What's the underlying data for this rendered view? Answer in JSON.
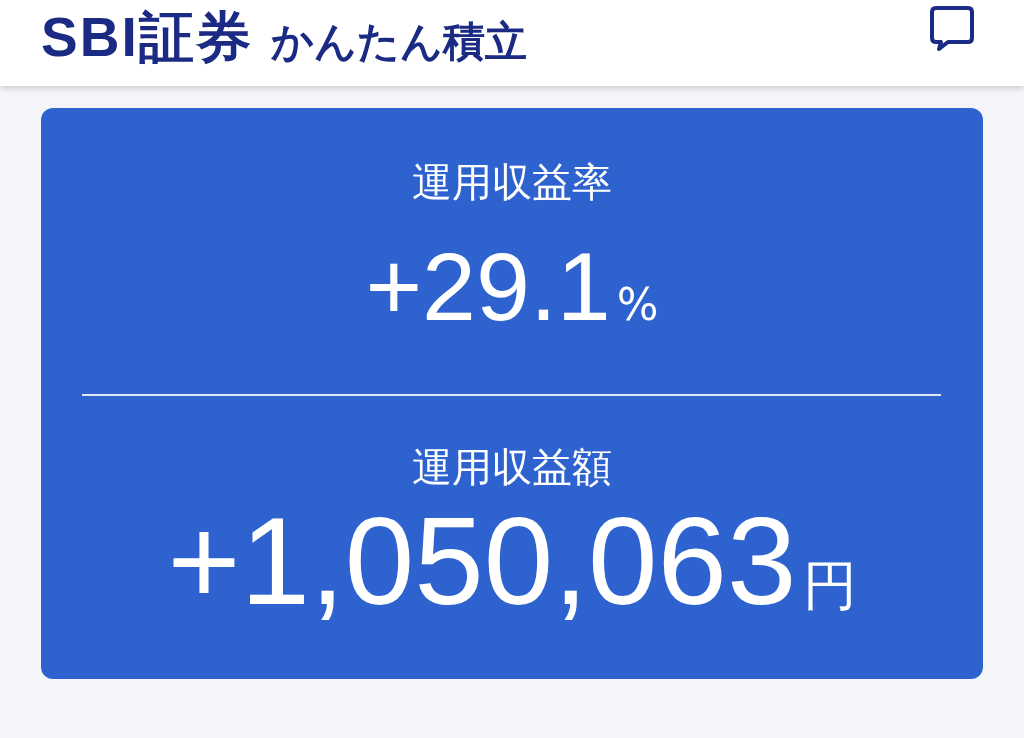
{
  "header": {
    "brand": "SBI証券",
    "product": "かんたん積立"
  },
  "summary": {
    "metrics": [
      {
        "kind": "rate",
        "label": "運用収益率",
        "value": "+29.1",
        "unit": "%"
      },
      {
        "kind": "amount",
        "label": "運用収益額",
        "value": "+1,050,063",
        "unit": "円"
      }
    ]
  }
}
